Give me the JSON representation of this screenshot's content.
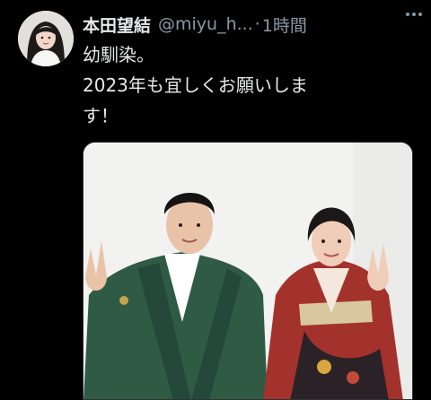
{
  "tweet": {
    "author_name": "本田望結",
    "author_handle": "@miyu_h...",
    "separator": "·",
    "time": "1時間",
    "text_lines": [
      "幼馴染。",
      "2023年も宜しくお願いしま",
      "す！"
    ]
  },
  "icons": {
    "avatar": "profile-avatar",
    "more": "more-options-icon",
    "photo": "attached-photo"
  }
}
